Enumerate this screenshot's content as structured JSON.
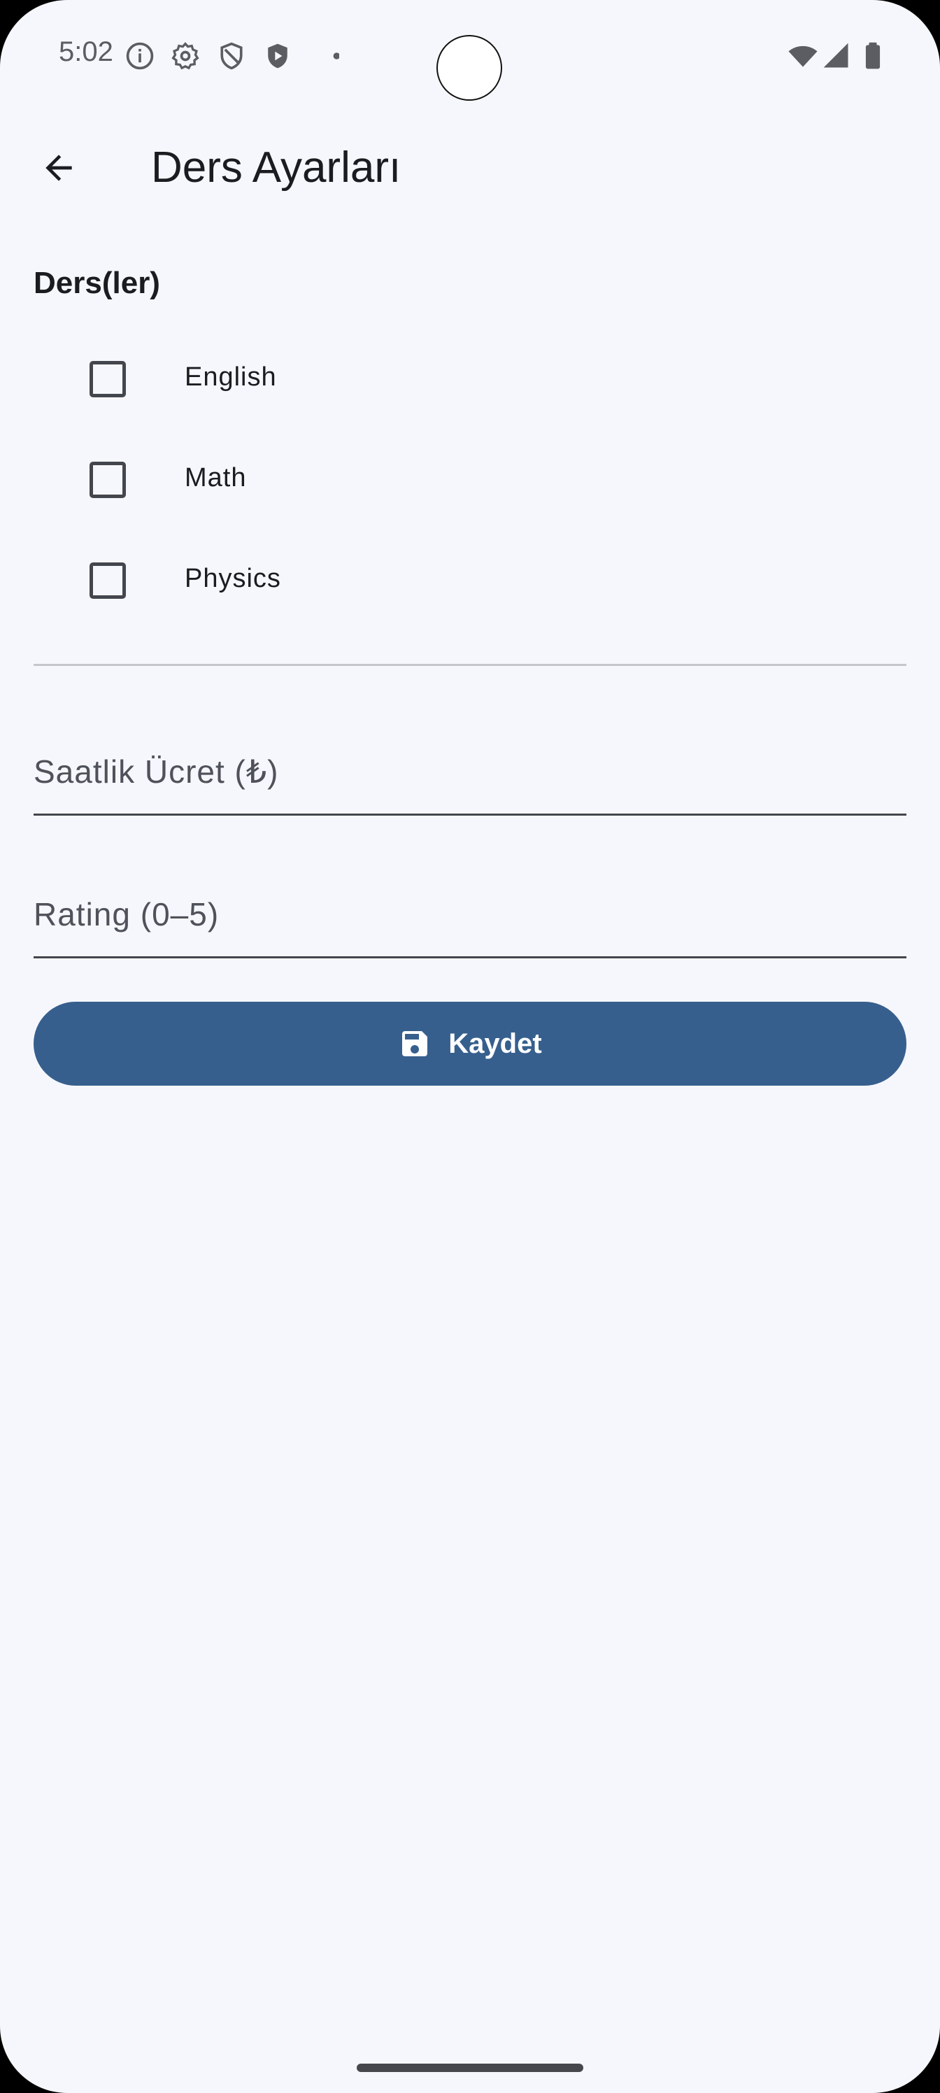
{
  "status_bar": {
    "time": "5:02",
    "left_icons": [
      "info-icon",
      "settings-icon",
      "shield-icon",
      "play-shield-icon",
      "dot-icon"
    ],
    "right_icons": [
      "wifi-icon",
      "cellular-signal-icon",
      "battery-icon"
    ]
  },
  "app_bar": {
    "back_icon": "arrow-back-icon",
    "title": "Ders Ayarları"
  },
  "lessons": {
    "section_title": "Ders(ler)",
    "items": [
      {
        "label": "English",
        "checked": false
      },
      {
        "label": "Math",
        "checked": false
      },
      {
        "label": "Physics",
        "checked": false
      }
    ]
  },
  "fields": {
    "hourly_rate": {
      "value": "",
      "placeholder": "Saatlik Ücret (₺)"
    },
    "rating": {
      "value": "",
      "placeholder": "Rating (0–5)"
    }
  },
  "save_button": {
    "icon": "save-icon",
    "label": "Kaydet"
  },
  "colors": {
    "background": "#f6f7fc",
    "primary": "#365f8d",
    "on_primary": "#ffffff",
    "text": "#1b1c20"
  }
}
